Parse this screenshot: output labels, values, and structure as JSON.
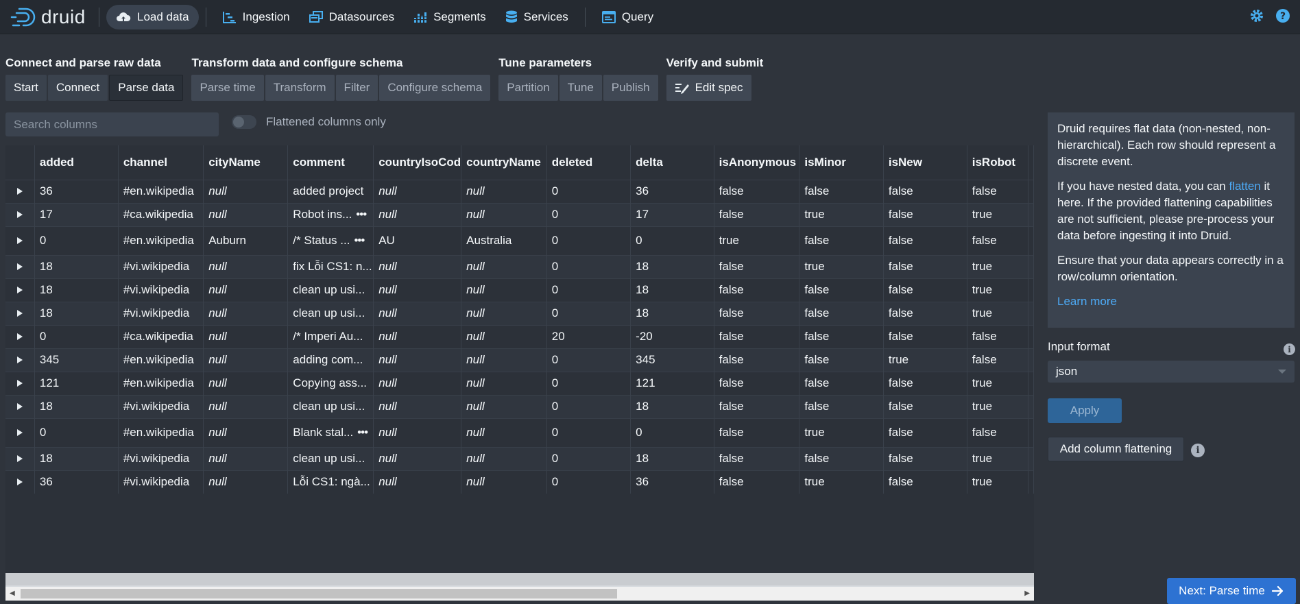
{
  "navbar": {
    "logo_text": "druid",
    "load_data": "Load data",
    "ingestion": "Ingestion",
    "datasources": "Datasources",
    "segments": "Segments",
    "services": "Services",
    "query": "Query"
  },
  "steps": {
    "group1_title": "Connect and parse raw data",
    "start": "Start",
    "connect": "Connect",
    "parse_data": "Parse data",
    "group2_title": "Transform data and configure schema",
    "parse_time": "Parse time",
    "transform": "Transform",
    "filter": "Filter",
    "configure_schema": "Configure schema",
    "group3_title": "Tune parameters",
    "partition": "Partition",
    "tune": "Tune",
    "publish": "Publish",
    "group4_title": "Verify and submit",
    "edit_spec": "Edit spec"
  },
  "search": {
    "placeholder": "Search columns"
  },
  "toggle": {
    "label": "Flattened columns only"
  },
  "table": {
    "columns": [
      "added",
      "channel",
      "cityName",
      "comment",
      "countryIsoCod",
      "countryName",
      "deleted",
      "delta",
      "isAnonymous",
      "isMinor",
      "isNew",
      "isRobot"
    ],
    "rows": [
      [
        "36",
        "#en.wikipedia",
        "null",
        "added project",
        "null",
        "null",
        "0",
        "36",
        "false",
        "false",
        "false",
        "false"
      ],
      [
        "17",
        "#ca.wikipedia",
        "null",
        "Robot ins...",
        "null",
        "null",
        "0",
        "17",
        "false",
        "true",
        "false",
        "true"
      ],
      [
        "0",
        "#en.wikipedia",
        "Auburn",
        "/* Status ...",
        "AU",
        "Australia",
        "0",
        "0",
        "true",
        "false",
        "false",
        "false"
      ],
      [
        "18",
        "#vi.wikipedia",
        "null",
        "fix Lỗi CS1: n...",
        "null",
        "null",
        "0",
        "18",
        "false",
        "true",
        "false",
        "true"
      ],
      [
        "18",
        "#vi.wikipedia",
        "null",
        "clean up usi...",
        "null",
        "null",
        "0",
        "18",
        "false",
        "false",
        "false",
        "true"
      ],
      [
        "18",
        "#vi.wikipedia",
        "null",
        "clean up usi...",
        "null",
        "null",
        "0",
        "18",
        "false",
        "false",
        "false",
        "true"
      ],
      [
        "0",
        "#ca.wikipedia",
        "null",
        "/* Imperi Au...",
        "null",
        "null",
        "20",
        "-20",
        "false",
        "false",
        "false",
        "false"
      ],
      [
        "345",
        "#en.wikipedia",
        "null",
        "adding com...",
        "null",
        "null",
        "0",
        "345",
        "false",
        "false",
        "true",
        "false"
      ],
      [
        "121",
        "#en.wikipedia",
        "null",
        "Copying ass...",
        "null",
        "null",
        "0",
        "121",
        "false",
        "false",
        "false",
        "true"
      ],
      [
        "18",
        "#vi.wikipedia",
        "null",
        "clean up usi...",
        "null",
        "null",
        "0",
        "18",
        "false",
        "false",
        "false",
        "true"
      ],
      [
        "0",
        "#en.wikipedia",
        "null",
        "Blank stal...",
        "null",
        "null",
        "0",
        "0",
        "false",
        "true",
        "false",
        "false"
      ],
      [
        "18",
        "#vi.wikipedia",
        "null",
        "clean up usi...",
        "null",
        "null",
        "0",
        "18",
        "false",
        "false",
        "false",
        "true"
      ],
      [
        "36",
        "#vi.wikipedia",
        "null",
        "Lỗi CS1: ngà...",
        "null",
        "null",
        "0",
        "36",
        "false",
        "true",
        "false",
        "true"
      ]
    ]
  },
  "info": {
    "p1": "Druid requires flat data (non-nested, non-hierarchical). Each row should represent a discrete event.",
    "p2_before": "If you have nested data, you can ",
    "p2_link": "flatten",
    "p2_after": " it here. If the provided flattening capabilities are not sufficient, please pre-process your data before ingesting it into Druid.",
    "p3": "Ensure that your data appears correctly in a row/column orientation.",
    "learn_more": "Learn more"
  },
  "form": {
    "input_format_label": "Input format",
    "input_format_value": "json",
    "apply": "Apply",
    "add_flattening": "Add column flattening",
    "next": "Next: Parse time"
  },
  "colors": {
    "accent": "#2d72d2",
    "link": "#4dabf7",
    "icon": "#48aff0"
  }
}
